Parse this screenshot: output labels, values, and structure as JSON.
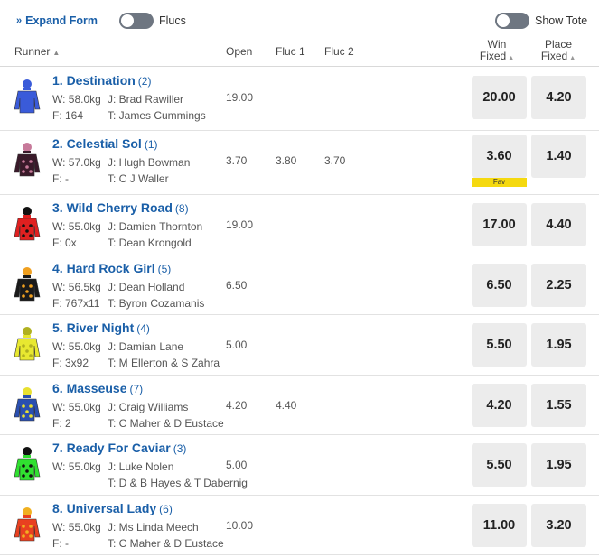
{
  "toolbar": {
    "expand_form_label": "Expand Form",
    "flucs_label": "Flucs",
    "show_tote_label": "Show Tote",
    "flucs_on": false,
    "show_tote_on": false
  },
  "columns": {
    "runner": "Runner",
    "open": "Open",
    "fluc1": "Fluc 1",
    "fluc2": "Fluc 2",
    "win_line1": "Win",
    "win_line2": "Fixed",
    "place_line1": "Place",
    "place_line2": "Fixed"
  },
  "fav_label": "Fav",
  "runners": [
    {
      "name": "1. Destination",
      "barrier": "(2)",
      "weight": "W: 58.0kg",
      "jockey": "J: Brad Rawiller",
      "form": "F: 164",
      "trainer": "T: James Cummings",
      "open": "19.00",
      "fluc1": "",
      "fluc2": "",
      "win": "20.00",
      "place": "4.20",
      "fav": false,
      "silk_colors": [
        "#3a5bd9",
        "#3a5bd9"
      ]
    },
    {
      "name": "2. Celestial Sol",
      "barrier": "(1)",
      "weight": "W: 57.0kg",
      "jockey": "J: Hugh Bowman",
      "form": "F: -",
      "trainer": "T: C J Waller",
      "open": "3.70",
      "fluc1": "3.80",
      "fluc2": "3.70",
      "win": "3.60",
      "place": "1.40",
      "fav": true,
      "silk_colors": [
        "#3a1a2a",
        "#c77a9a"
      ]
    },
    {
      "name": "3. Wild Cherry Road",
      "barrier": "(8)",
      "weight": "W: 55.0kg",
      "jockey": "J: Damien Thornton",
      "form": "F: 0x",
      "trainer": "T: Dean Krongold",
      "open": "19.00",
      "fluc1": "",
      "fluc2": "",
      "win": "17.00",
      "place": "4.40",
      "fav": false,
      "silk_colors": [
        "#e02020",
        "#111111"
      ]
    },
    {
      "name": "4. Hard Rock Girl",
      "barrier": "(5)",
      "weight": "W: 56.5kg",
      "jockey": "J: Dean Holland",
      "form": "F: 767x11",
      "trainer": "T: Byron Cozamanis",
      "open": "6.50",
      "fluc1": "",
      "fluc2": "",
      "win": "6.50",
      "place": "2.25",
      "fav": false,
      "silk_colors": [
        "#1a1a1a",
        "#f0a020"
      ]
    },
    {
      "name": "5. River Night",
      "barrier": "(4)",
      "weight": "W: 55.0kg",
      "jockey": "J: Damian Lane",
      "form": "F: 3x92",
      "trainer": "T: M Ellerton & S Zahra",
      "open": "5.00",
      "fluc1": "",
      "fluc2": "",
      "win": "5.50",
      "place": "1.95",
      "fav": false,
      "silk_colors": [
        "#e8e830",
        "#b0b020"
      ]
    },
    {
      "name": "6. Masseuse",
      "barrier": "(7)",
      "weight": "W: 55.0kg",
      "jockey": "J: Craig Williams",
      "form": "F: 2",
      "trainer": "T: C Maher & D Eustace",
      "open": "4.20",
      "fluc1": "4.40",
      "fluc2": "",
      "win": "4.20",
      "place": "1.55",
      "fav": false,
      "silk_colors": [
        "#2a4fb0",
        "#e8e030"
      ]
    },
    {
      "name": "7. Ready For Caviar",
      "barrier": "(3)",
      "weight": "W: 55.0kg",
      "jockey": "J: Luke Nolen",
      "form": "",
      "trainer": "T: D & B Hayes & T Dabernig",
      "open": "5.00",
      "fluc1": "",
      "fluc2": "",
      "win": "5.50",
      "place": "1.95",
      "fav": false,
      "silk_colors": [
        "#30e030",
        "#111111"
      ]
    },
    {
      "name": "8. Universal Lady",
      "barrier": "(6)",
      "weight": "W: 55.0kg",
      "jockey": "J: Ms Linda Meech",
      "form": "F: -",
      "trainer": "T: C Maher & D Eustace",
      "open": "10.00",
      "fluc1": "",
      "fluc2": "",
      "win": "11.00",
      "place": "3.20",
      "fav": false,
      "silk_colors": [
        "#e84020",
        "#f0b020"
      ]
    }
  ]
}
